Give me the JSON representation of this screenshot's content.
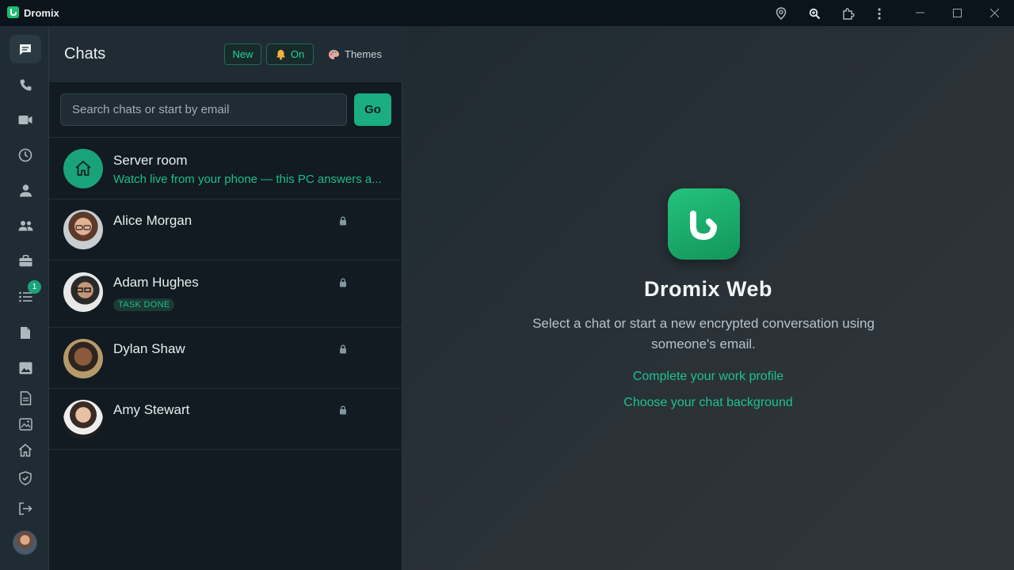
{
  "window": {
    "app_name": "Dromix",
    "titlebar_icons": [
      "location-pin-icon",
      "zoom-icon",
      "extension-icon",
      "more-vertical-icon"
    ]
  },
  "rail": {
    "items": [
      {
        "name": "chats",
        "icon": "chat-icon",
        "active": true
      },
      {
        "name": "calls",
        "icon": "phone-icon"
      },
      {
        "name": "video",
        "icon": "video-icon"
      },
      {
        "name": "history",
        "icon": "clock-icon"
      },
      {
        "name": "contacts",
        "icon": "person-icon"
      },
      {
        "name": "groups",
        "icon": "people-icon"
      },
      {
        "name": "work",
        "icon": "briefcase-icon"
      },
      {
        "name": "tasks",
        "icon": "list-icon",
        "badge": "1"
      },
      {
        "name": "files",
        "icon": "file-icon"
      },
      {
        "name": "photos",
        "icon": "image-icon"
      },
      {
        "name": "notes",
        "icon": "document-icon"
      },
      {
        "name": "gallery",
        "icon": "gallery-icon"
      },
      {
        "name": "home",
        "icon": "home-icon"
      },
      {
        "name": "security",
        "icon": "shield-icon"
      },
      {
        "name": "logout",
        "icon": "logout-icon"
      }
    ]
  },
  "panel": {
    "title": "Chats",
    "new_label": "New",
    "notify_label": "On",
    "themes_label": "Themes",
    "search_placeholder": "Search chats or start by email",
    "go_label": "Go"
  },
  "chats": [
    {
      "name": "Server room",
      "subtitle": "Watch live from your phone — this PC answers a..."
    },
    {
      "name": "Alice Morgan"
    },
    {
      "name": "Adam Hughes",
      "tag": "TASK DONE"
    },
    {
      "name": "Dylan Shaw"
    },
    {
      "name": "Amy Stewart"
    }
  ],
  "main": {
    "title": "Dromix Web",
    "description": "Select a chat or start a new encrypted conversation using someone's email.",
    "link_profile": "Complete your work profile",
    "link_background": "Choose your chat background"
  },
  "colors": {
    "accent": "#1ebc8a",
    "background": "#111b21",
    "panel_header": "#1f2c33"
  }
}
